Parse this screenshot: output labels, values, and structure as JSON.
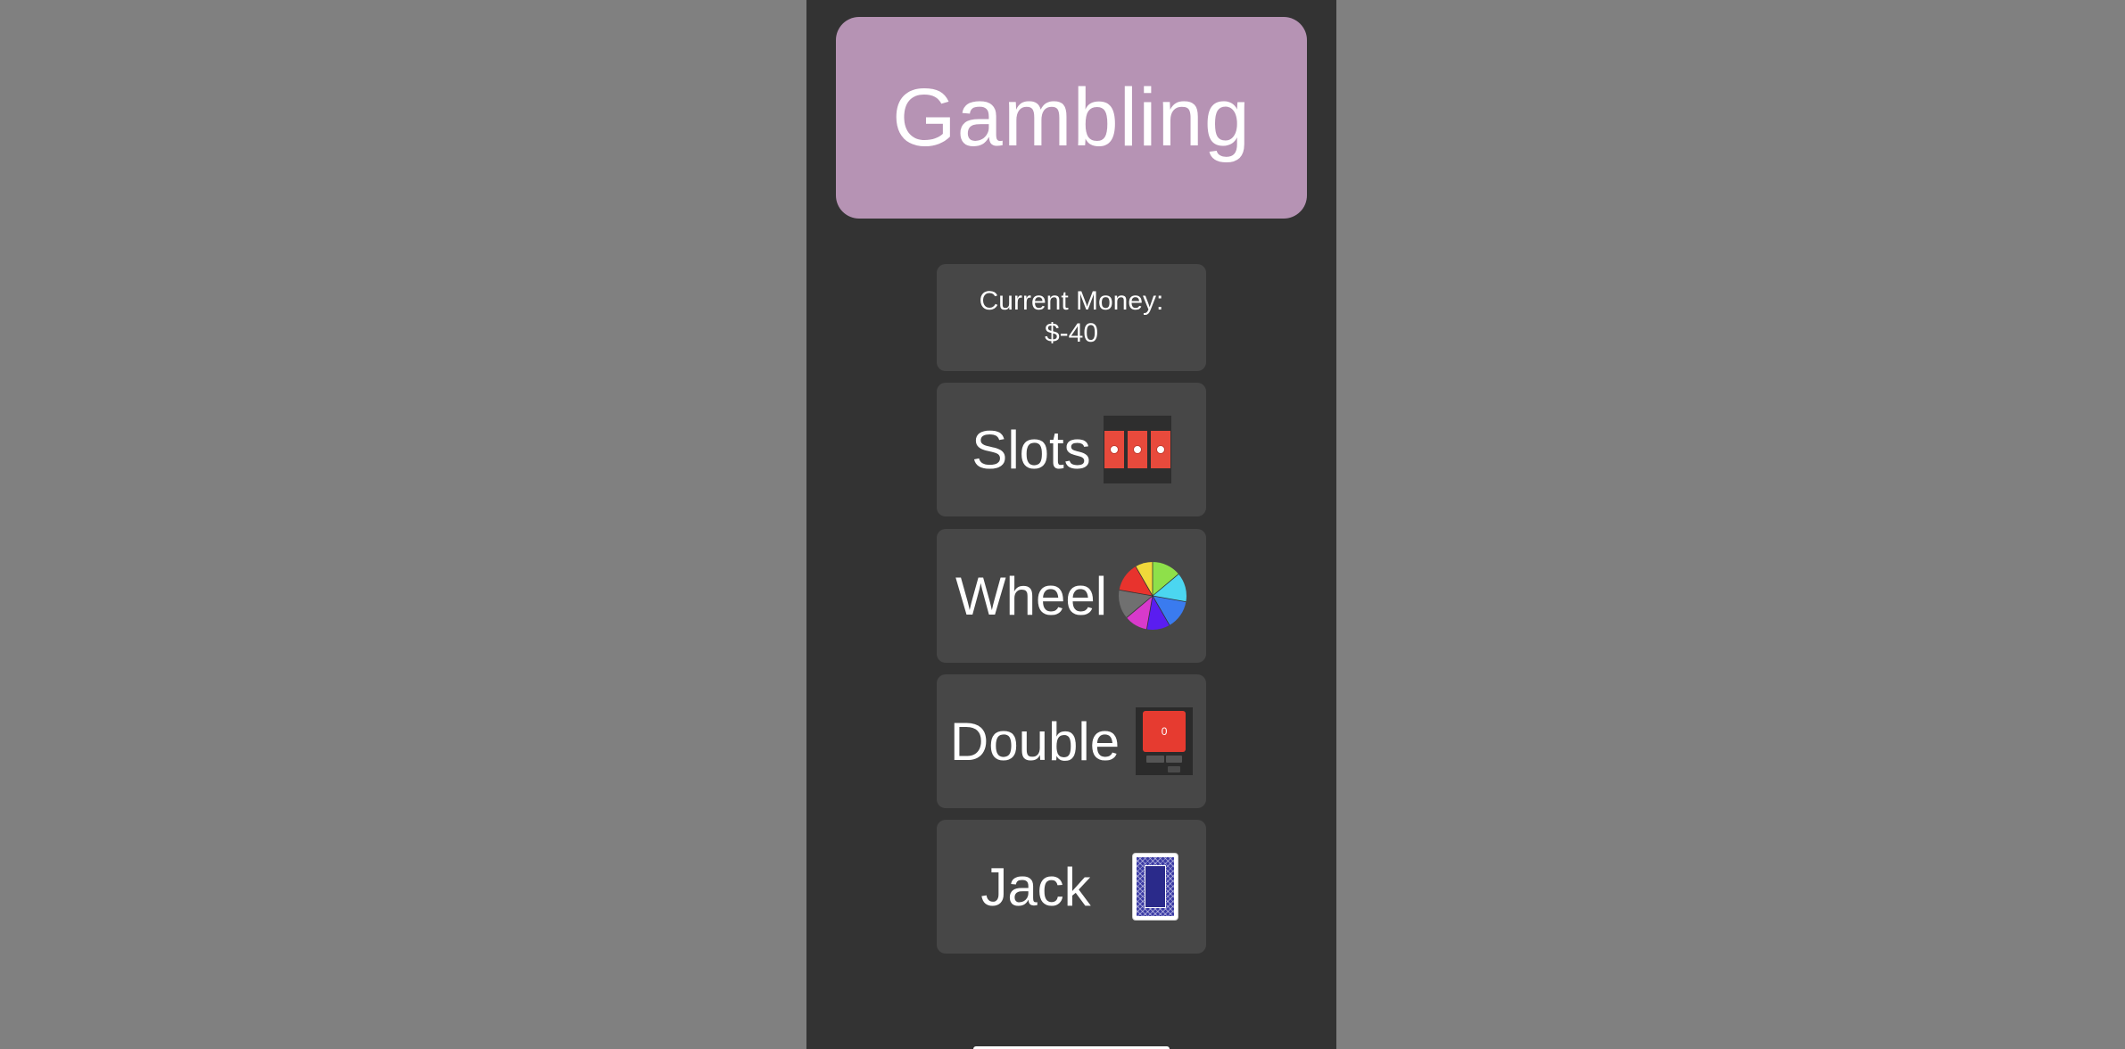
{
  "header": {
    "title": "Gambling"
  },
  "money": {
    "label": "Current Money:",
    "value": "$-40"
  },
  "games": {
    "slots": {
      "label": "Slots",
      "icon": "slot-machine-icon"
    },
    "wheel": {
      "label": "Wheel",
      "icon": "wheel-icon"
    },
    "double": {
      "label": "Double",
      "icon": "double-game-icon",
      "tile_value": "0"
    },
    "jack": {
      "label": "Jack",
      "icon": "card-back-icon"
    }
  },
  "colors": {
    "background": "#808080",
    "screen": "#333333",
    "header": "#b693b4",
    "card": "#474747",
    "accent_red": "#e84a3c"
  }
}
